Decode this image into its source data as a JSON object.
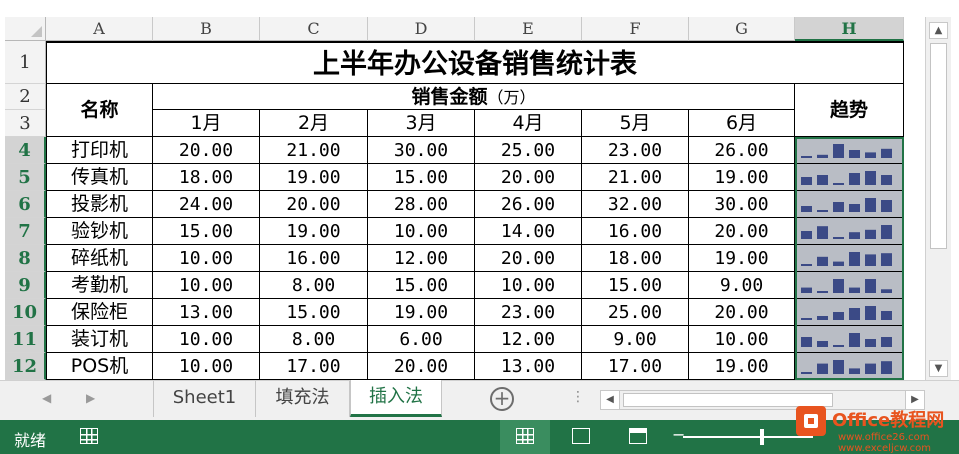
{
  "columns": [
    "A",
    "B",
    "C",
    "D",
    "E",
    "F",
    "G",
    "H"
  ],
  "rows": [
    "1",
    "2",
    "3",
    "4",
    "5",
    "6",
    "7",
    "8",
    "9",
    "10",
    "11",
    "12"
  ],
  "selected_column": "H",
  "table": {
    "title": "上半年办公设备销售统计表",
    "name_header": "名称",
    "sales_header": "销售金额",
    "sales_unit": "（万）",
    "trend_header": "趋势",
    "months": [
      "1月",
      "2月",
      "3月",
      "4月",
      "5月",
      "6月"
    ],
    "items": [
      {
        "name": "打印机",
        "values": [
          "20.00",
          "21.00",
          "30.00",
          "25.00",
          "23.00",
          "26.00"
        ]
      },
      {
        "name": "传真机",
        "values": [
          "18.00",
          "19.00",
          "15.00",
          "20.00",
          "21.00",
          "19.00"
        ]
      },
      {
        "name": "投影机",
        "values": [
          "24.00",
          "20.00",
          "28.00",
          "26.00",
          "32.00",
          "30.00"
        ]
      },
      {
        "name": "验钞机",
        "values": [
          "15.00",
          "19.00",
          "10.00",
          "14.00",
          "16.00",
          "20.00"
        ]
      },
      {
        "name": "碎纸机",
        "values": [
          "10.00",
          "16.00",
          "12.00",
          "20.00",
          "18.00",
          "19.00"
        ]
      },
      {
        "name": "考勤机",
        "values": [
          "10.00",
          "8.00",
          "15.00",
          "10.00",
          "15.00",
          "9.00"
        ]
      },
      {
        "name": "保险柜",
        "values": [
          "13.00",
          "15.00",
          "19.00",
          "23.00",
          "25.00",
          "20.00"
        ]
      },
      {
        "name": "装订机",
        "values": [
          "10.00",
          "8.00",
          "6.00",
          "12.00",
          "9.00",
          "10.00"
        ]
      },
      {
        "name": "POS机",
        "values": [
          "10.00",
          "17.00",
          "20.00",
          "13.00",
          "17.00",
          "19.00"
        ]
      }
    ]
  },
  "sparkline_color": "#3b4a86",
  "sparkline_bg": "#b9bdc5",
  "sheet_tabs": [
    "Sheet1",
    "填充法",
    "插入法"
  ],
  "active_tab": "插入法",
  "status": {
    "ready": "就绪"
  },
  "accent": "#217346",
  "logo": {
    "brand": "Office教程网",
    "url": "www.office26.com",
    "site": "www.exceljcw.com"
  }
}
